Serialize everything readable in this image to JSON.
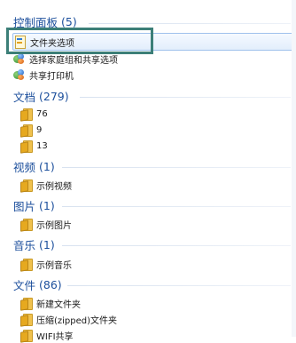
{
  "groups": {
    "control_panel": {
      "title": "控制面板",
      "count": "(5)",
      "items": [
        "文件夹选项",
        "选择家庭组和共享选项",
        "共享打印机"
      ]
    },
    "documents": {
      "title": "文档",
      "count": "(279)",
      "items": [
        "76",
        "9",
        "13"
      ]
    },
    "videos": {
      "title": "视频",
      "count": "(1)",
      "items": [
        "示例视频"
      ]
    },
    "pictures": {
      "title": "图片",
      "count": "(1)",
      "items": [
        "示例图片"
      ]
    },
    "music": {
      "title": "音乐",
      "count": "(1)",
      "items": [
        "示例音乐"
      ]
    },
    "files": {
      "title": "文件",
      "count": "(86)",
      "items": [
        "新建文件夹",
        "压缩(zipped)文件夹",
        "WIFI共享"
      ]
    }
  },
  "colors": {
    "group_header": "#1c4f9c",
    "highlight_box": "#3c7f78",
    "selection": "#e3eefc"
  },
  "icons": {
    "folder": "folder-icon",
    "folder_options": "folder-options-icon",
    "network": "homegroup-icon",
    "printer_share": "share-printer-icon"
  }
}
